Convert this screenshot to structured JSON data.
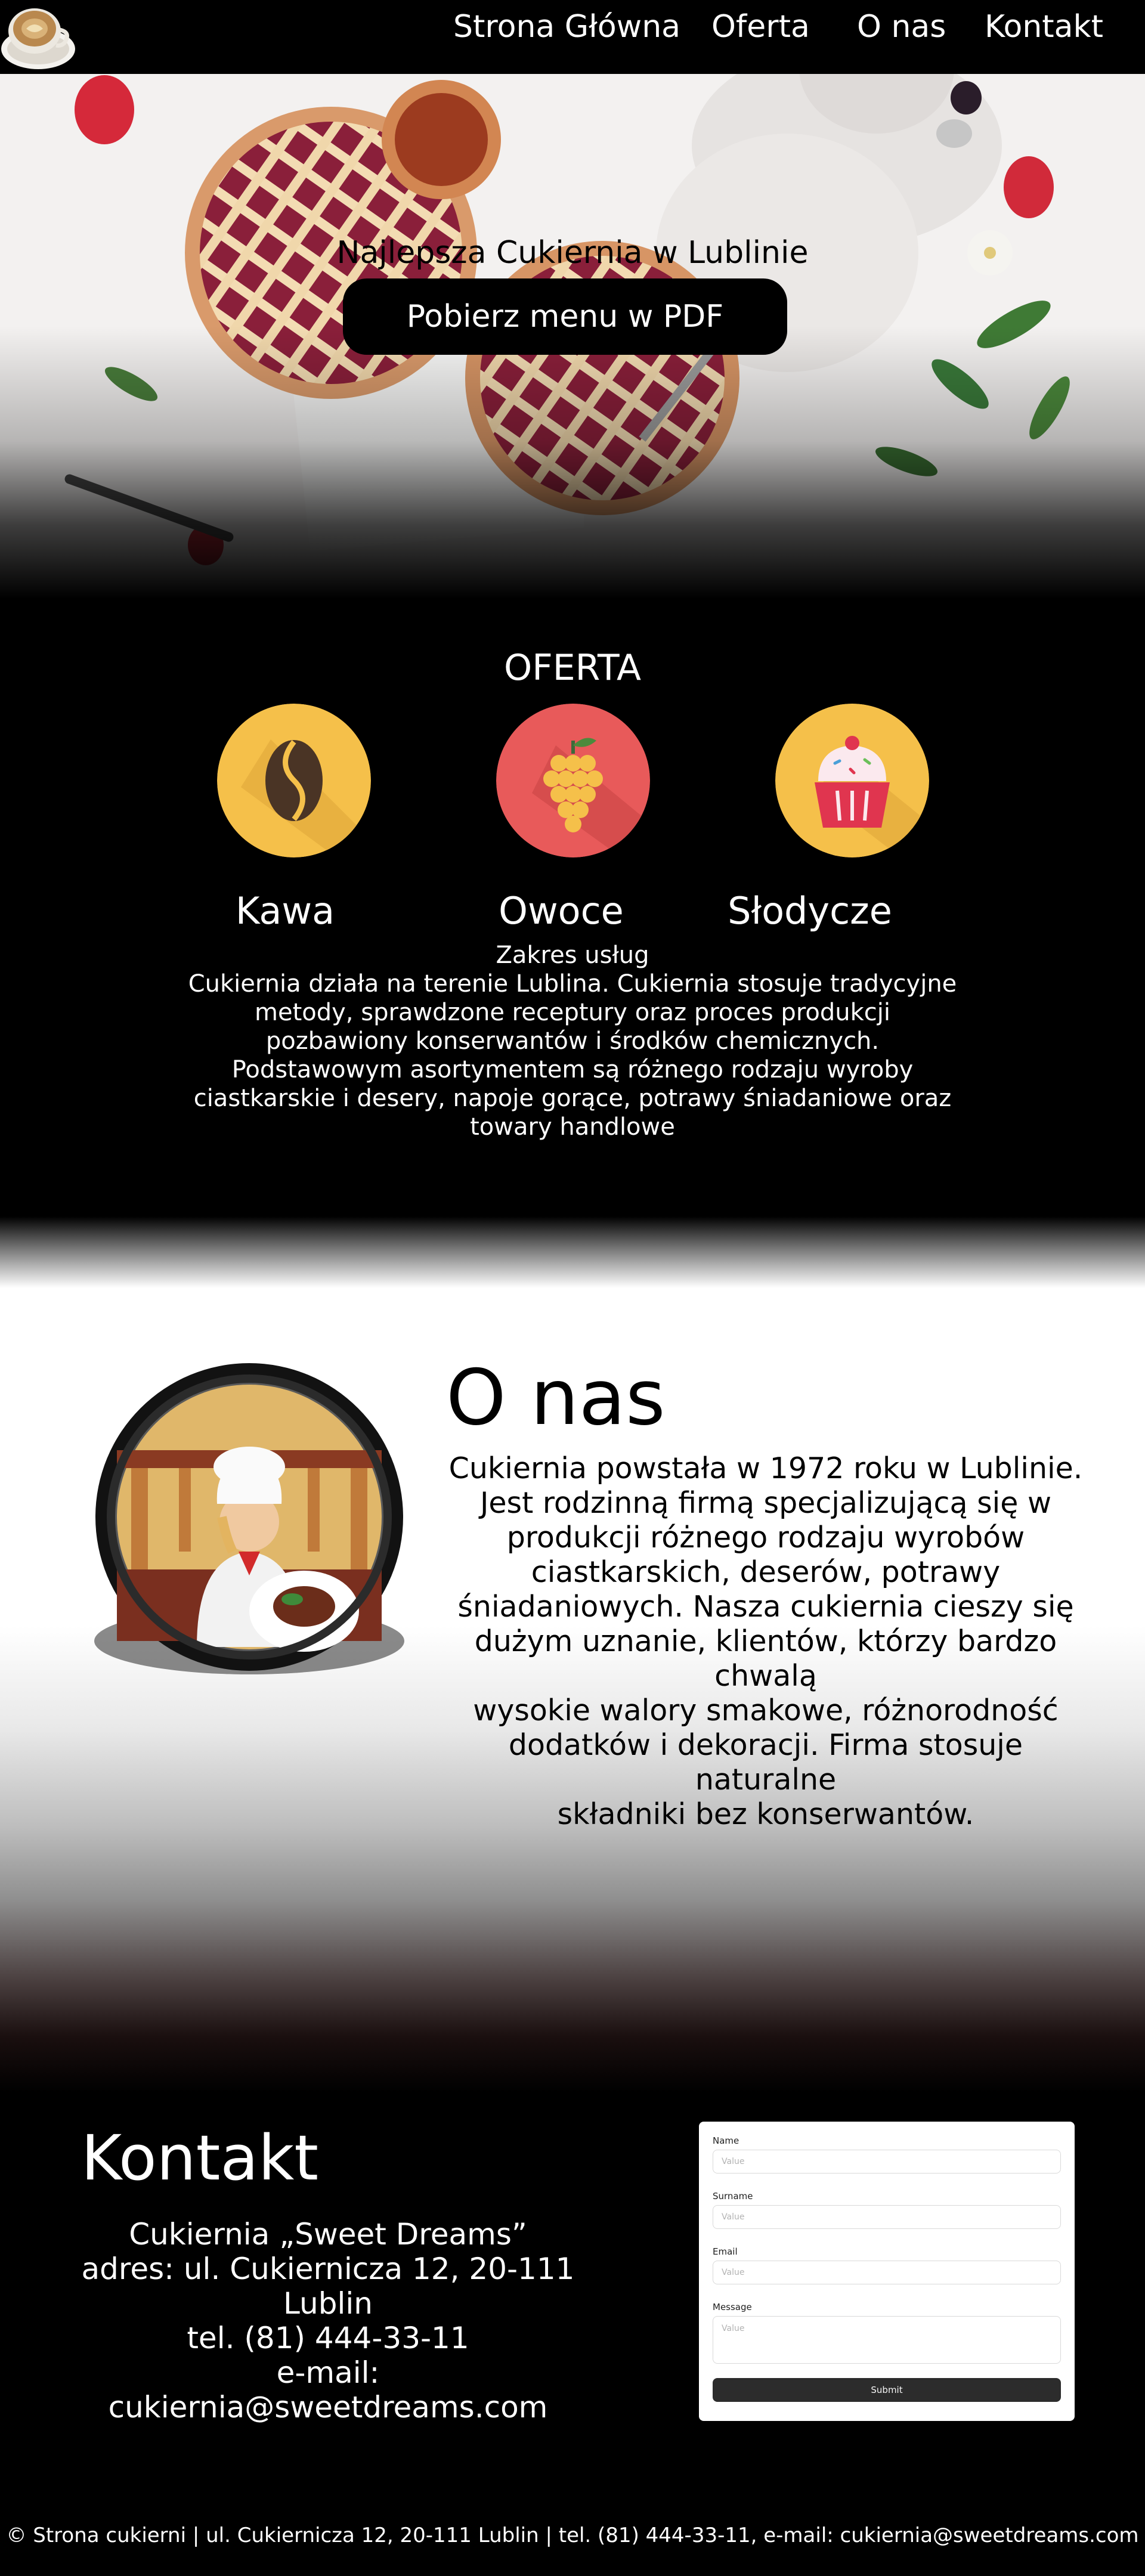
{
  "nav": {
    "items": [
      "Strona Główna",
      "Oferta",
      "O nas",
      "Kontakt"
    ]
  },
  "hero": {
    "title": "Najlepsza Cukiernia w Lublinie",
    "button": "Pobierz menu w PDF"
  },
  "oferta": {
    "title": "OFERTA",
    "categories": [
      {
        "label": "Kawa",
        "icon": "coffee-bean-icon",
        "color": "#f5c04a"
      },
      {
        "label": "Owoce",
        "icon": "grapes-icon",
        "color": "#e85a5a"
      },
      {
        "label": "Słodycze",
        "icon": "cupcake-icon",
        "color": "#f5c04a"
      }
    ],
    "service_lines": [
      "Zakres usług",
      "Cukiernia działa na terenie Lublina. Cukiernia stosuje tradycyjne",
      "metody, sprawdzone receptury oraz proces produkcji",
      "pozbawiony konserwantów i środków chemicznych.",
      "Podstawowym asortymentem są różnego rodzaju wyroby",
      "ciastkarskie i desery, napoje gorące, potrawy śniadaniowe oraz",
      "towary handlowe"
    ]
  },
  "onas": {
    "title": "O nas",
    "lines": [
      "Cukiernia powstała w 1972 roku w Lublinie.",
      "Jest rodzinną firmą specjalizującą się w",
      "produkcji różnego rodzaju wyrobów",
      "ciastkarskich, deserów, potrawy",
      "śniadaniowych. Nasza cukiernia cieszy się",
      "dużym uznanie, klientów, którzy bardzo chwalą",
      "wysokie walory smakowe, różnorodność",
      "dodatków i dekoracji. Firma stosuje naturalne",
      "składniki bez konserwantów."
    ]
  },
  "kontakt": {
    "title": "Kontakt",
    "lines": [
      "Cukiernia „Sweet Dreams”",
      "adres: ul. Cukiernicza 12, 20-111 Lublin",
      "tel. (81) 444-33-11",
      "e-mail: cukiernia@sweetdreams.com"
    ],
    "form": {
      "name_label": "Name",
      "name_placeholder": "Value",
      "surname_label": "Surname",
      "surname_placeholder": "Value",
      "email_label": "Email",
      "email_placeholder": "Value",
      "message_label": "Message",
      "message_placeholder": "Value",
      "submit": "Submit"
    }
  },
  "footer": {
    "text": "© Strona cukierni | ul. Cukiernicza 12, 20-111 Lublin | tel. (81) 444-33-11, e-mail: cukiernia@sweetdreams.com"
  }
}
